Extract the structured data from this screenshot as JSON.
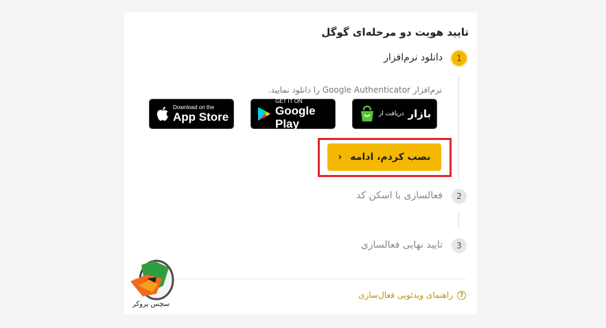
{
  "page_title": "تایید هویت دو مرحله‌ای گوگل",
  "steps": [
    {
      "number": "1",
      "label": "دانلود نرم‌افزار"
    },
    {
      "number": "2",
      "label": "فعالسازی با اسکن کد"
    },
    {
      "number": "3",
      "label": "تایید نهایی فعالسازی"
    }
  ],
  "instructions": "نرم‌افزار Google Authenticator را دانلود نمایید.",
  "stores": {
    "bazaar": {
      "small": "دریافت از",
      "big": "بازار"
    },
    "google_play": {
      "small": "GET IT ON",
      "big": "Google Play"
    },
    "app_store": {
      "small": "Download on the",
      "big": "App Store"
    }
  },
  "continue_button": "نصب کردم، ادامه",
  "help_link": "راهنمای ویدئویی فعال‌سازی",
  "logo_text": "سچس بروکر",
  "colors": {
    "accent": "#f5b800",
    "highlight": "#e0262f",
    "link": "#c29200"
  }
}
